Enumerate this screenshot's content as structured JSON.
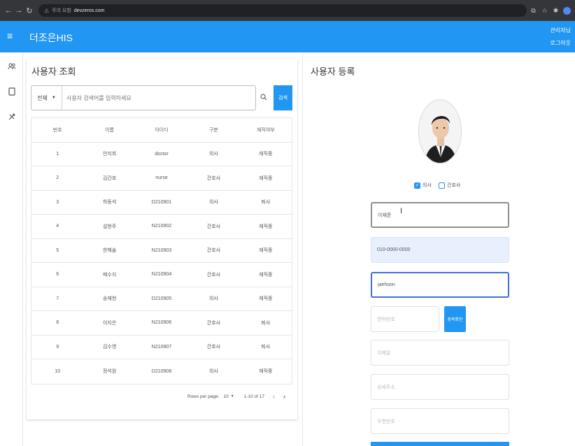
{
  "browser": {
    "security_label": "주의 요함",
    "host": "devzeros.com"
  },
  "appbar": {
    "title": "더조은HIS",
    "user_label": "관리자님",
    "logout_label": "로그아웃"
  },
  "user_search": {
    "title": "사용자 조회",
    "filter_value": "전체",
    "search_placeholder": "사용자 검색어를 입력하세요",
    "search_button": "검색",
    "columns": [
      "번호",
      "이름",
      "아이디",
      "구분",
      "재직여부"
    ],
    "rows": [
      [
        "1",
        "안지희",
        "doctor",
        "의사",
        "재직중"
      ],
      [
        "2",
        "김간호",
        "nurse",
        "간호사",
        "재직중"
      ],
      [
        "3",
        "하동석",
        "D210901",
        "의사",
        "퇴사"
      ],
      [
        "4",
        "설현주",
        "N210902",
        "간호사",
        "재직중"
      ],
      [
        "5",
        "한해솔",
        "N210903",
        "간호사",
        "재직중"
      ],
      [
        "6",
        "배수지",
        "N210904",
        "간호사",
        "재직중"
      ],
      [
        "7",
        "송재현",
        "D210905",
        "의사",
        "재직중"
      ],
      [
        "8",
        "이지은",
        "N210906",
        "간호사",
        "퇴사"
      ],
      [
        "9",
        "김수영",
        "N210907",
        "간호사",
        "퇴사"
      ],
      [
        "10",
        "정석원",
        "D210908",
        "의사",
        "재직중"
      ]
    ],
    "pagination": {
      "rows_per_page_label": "Rows per page:",
      "rows_per_page_value": "10",
      "range": "1-10 of 17"
    }
  },
  "user_register": {
    "title": "사용자 등록",
    "role_options": [
      {
        "label": "의사",
        "checked": true
      },
      {
        "label": "간호사",
        "checked": false
      }
    ],
    "fields": {
      "name": "이재준",
      "phone": "010-0000-0000",
      "user_id": "jaehoon",
      "license_placeholder": "면허번호",
      "duplicate_check_button": "중복확인",
      "email_placeholder": "이메일",
      "address_placeholder": "상세주소",
      "zip_placeholder": "우편번호"
    }
  },
  "colors": {
    "primary": "#2196f3",
    "chrome": "#35363a",
    "autofill": "#e8f0fe"
  }
}
